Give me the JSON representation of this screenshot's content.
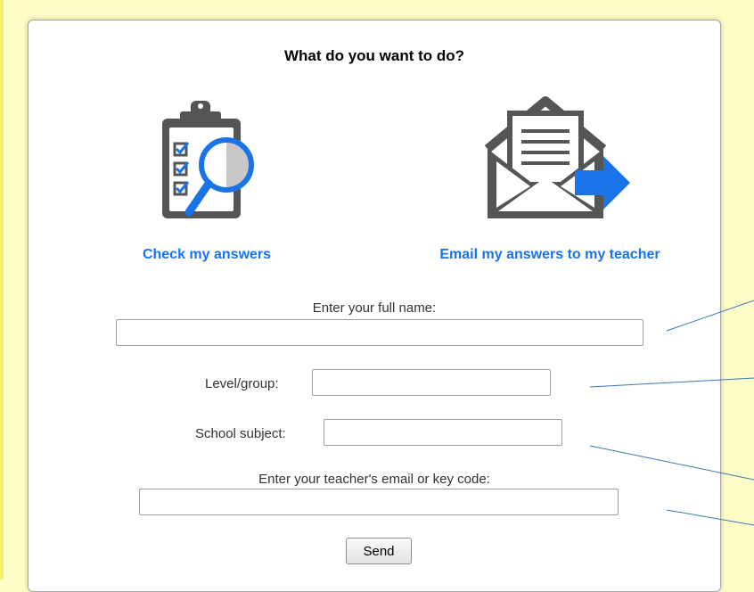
{
  "dialog": {
    "title": "What do you want to do?",
    "check_label": "Check my answers",
    "email_label": "Email my answers to my teacher"
  },
  "form": {
    "full_name_label": "Enter your full name:",
    "full_name_value": "",
    "level_label": "Level/group:",
    "level_value": "",
    "subject_label": "School subject:",
    "subject_value": "",
    "teacher_label": "Enter your teacher's email or key code:",
    "teacher_value": "",
    "send_label": "Send"
  },
  "icons": {
    "check": "clipboard-magnifier-icon",
    "email": "envelope-arrow-icon"
  },
  "colors": {
    "background": "#fffdc7",
    "link_blue": "#1a73e8",
    "icon_gray": "#555555",
    "annotation_line": "#3b78b8"
  }
}
